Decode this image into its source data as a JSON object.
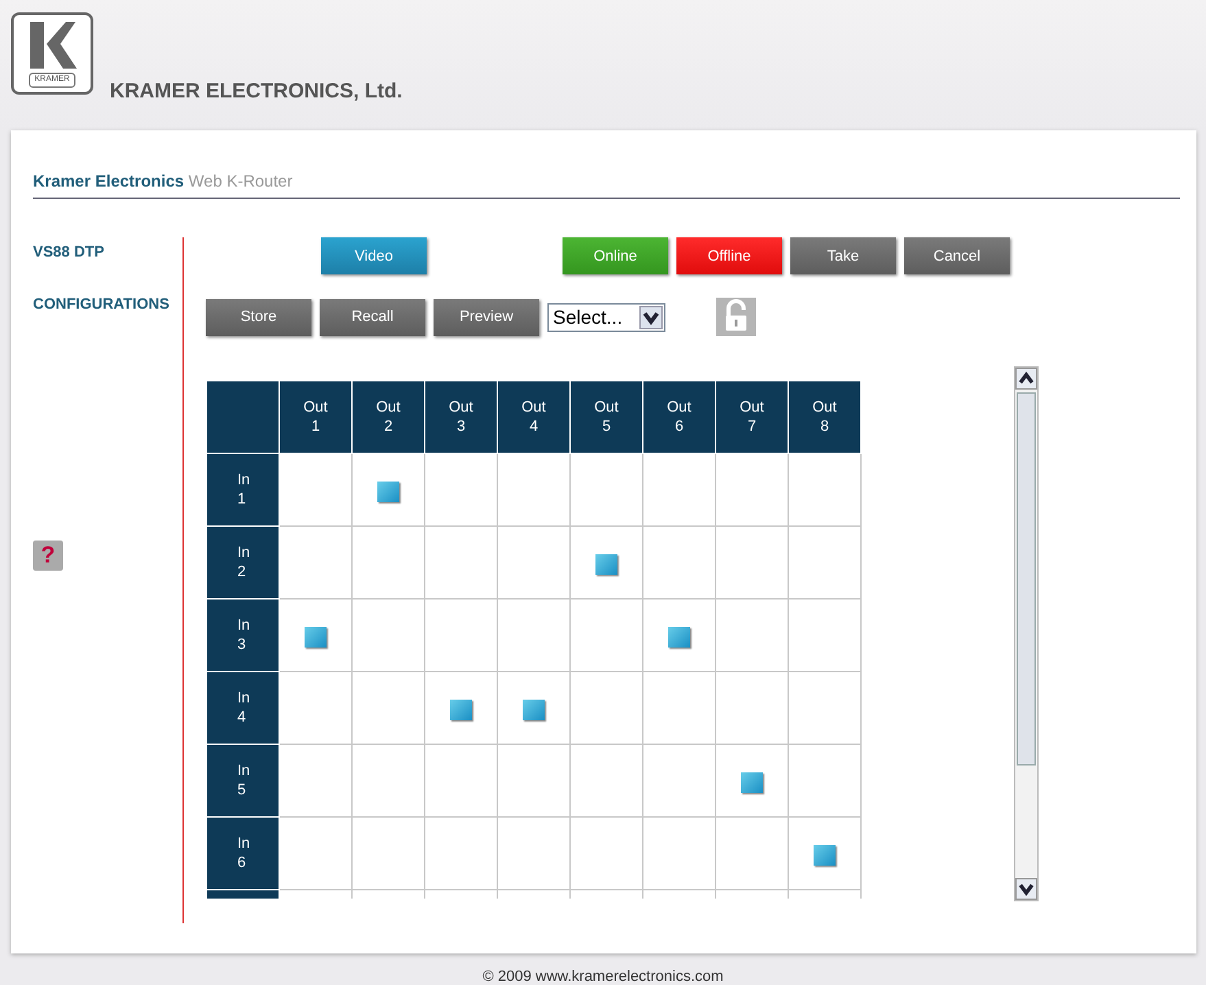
{
  "header": {
    "logo_caption": "KRAMER",
    "title": "KRAMER ELECTRONICS, Ltd."
  },
  "breadcrumb": {
    "brand": "Kramer Electronics",
    "page": "Web K-Router"
  },
  "sidebar": {
    "items": [
      "VS88 DTP",
      "CONFIGURATIONS"
    ],
    "help": "?"
  },
  "toolbar": {
    "mode_button": "Video",
    "buttons": [
      {
        "label": "Online",
        "kind": "online"
      },
      {
        "label": "Offline",
        "kind": "offline"
      },
      {
        "label": "Take",
        "kind": "plain"
      },
      {
        "label": "Cancel",
        "kind": "plain"
      }
    ],
    "preset_buttons": [
      "Store",
      "Recall",
      "Preview"
    ],
    "preset_select": "Select..."
  },
  "matrix": {
    "outputs": [
      {
        "label": "Out",
        "number": "1"
      },
      {
        "label": "Out",
        "number": "2"
      },
      {
        "label": "Out",
        "number": "3"
      },
      {
        "label": "Out",
        "number": "4"
      },
      {
        "label": "Out",
        "number": "5"
      },
      {
        "label": "Out",
        "number": "6"
      },
      {
        "label": "Out",
        "number": "7"
      },
      {
        "label": "Out",
        "number": "8"
      }
    ],
    "rows": [
      {
        "label": "In",
        "number": "1",
        "cells": [
          {
            "connected": false
          },
          {
            "connected": true
          },
          {
            "connected": false
          },
          {
            "connected": false
          },
          {
            "connected": false
          },
          {
            "connected": false
          },
          {
            "connected": false
          },
          {
            "connected": false
          }
        ]
      },
      {
        "label": "In",
        "number": "2",
        "cells": [
          {
            "connected": false
          },
          {
            "connected": false
          },
          {
            "connected": false
          },
          {
            "connected": false
          },
          {
            "connected": true
          },
          {
            "connected": false
          },
          {
            "connected": false
          },
          {
            "connected": false
          }
        ]
      },
      {
        "label": "In",
        "number": "3",
        "cells": [
          {
            "connected": true
          },
          {
            "connected": false
          },
          {
            "connected": false
          },
          {
            "connected": false
          },
          {
            "connected": false
          },
          {
            "connected": true
          },
          {
            "connected": false
          },
          {
            "connected": false
          }
        ]
      },
      {
        "label": "In",
        "number": "4",
        "cells": [
          {
            "connected": false
          },
          {
            "connected": false
          },
          {
            "connected": true
          },
          {
            "connected": true
          },
          {
            "connected": false
          },
          {
            "connected": false
          },
          {
            "connected": false
          },
          {
            "connected": false
          }
        ]
      },
      {
        "label": "In",
        "number": "5",
        "cells": [
          {
            "connected": false
          },
          {
            "connected": false
          },
          {
            "connected": false
          },
          {
            "connected": false
          },
          {
            "connected": false
          },
          {
            "connected": false
          },
          {
            "connected": true
          },
          {
            "connected": false
          }
        ]
      },
      {
        "label": "In",
        "number": "6",
        "cells": [
          {
            "connected": false
          },
          {
            "connected": false
          },
          {
            "connected": false
          },
          {
            "connected": false
          },
          {
            "connected": false
          },
          {
            "connected": false
          },
          {
            "connected": false
          },
          {
            "connected": true
          }
        ]
      }
    ]
  },
  "footer": "© 2009 www.kramerelectronics.com"
}
